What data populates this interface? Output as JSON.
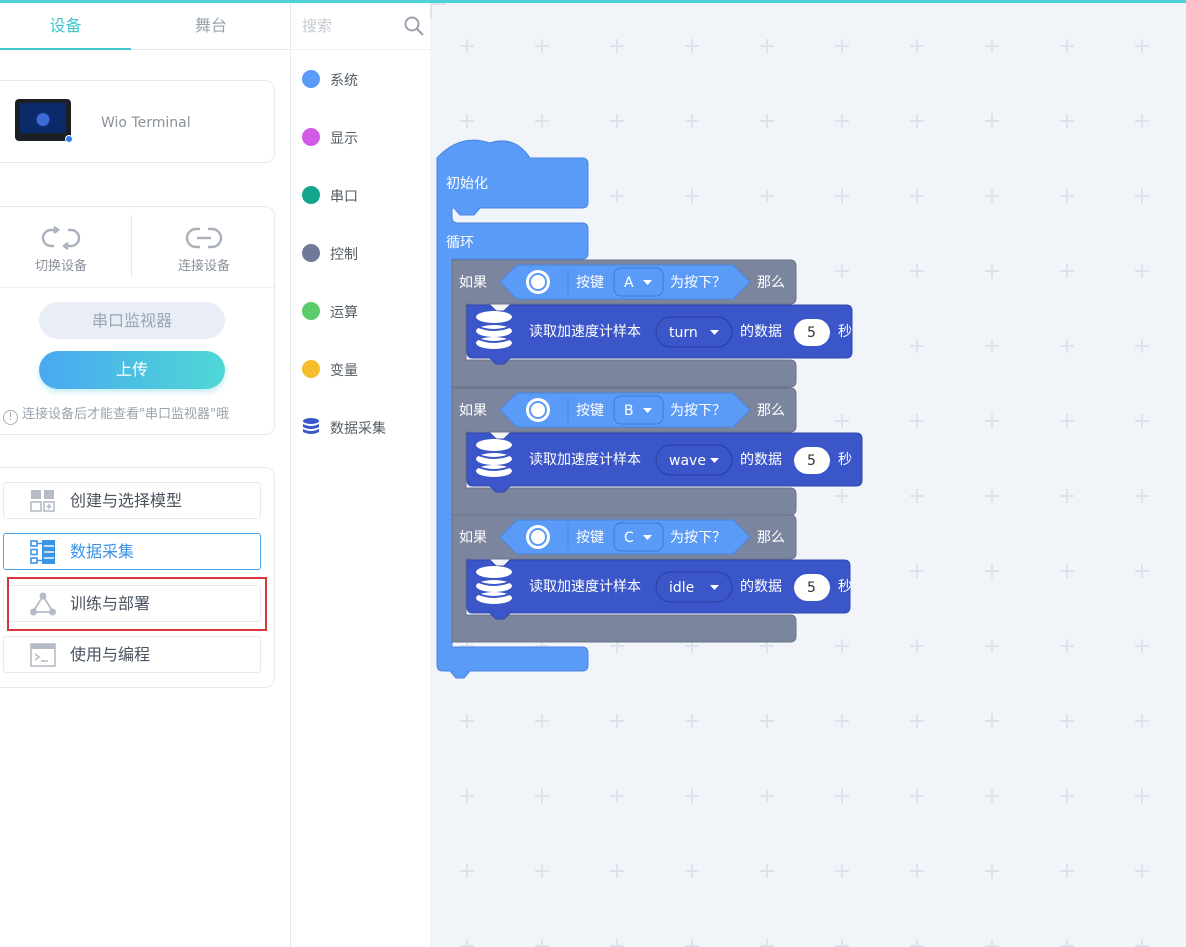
{
  "tabs": [
    {
      "label": "设备"
    },
    {
      "label": "舞台"
    }
  ],
  "device": {
    "name": "Wio Terminal"
  },
  "connection": {
    "switch_label": "切换设备",
    "connect_label": "连接设备",
    "serial_monitor_label": "串口监视器",
    "upload_label": "上传",
    "hint": "连接设备后才能查看\"串口监视器\"哦",
    "hint_icon": "!"
  },
  "menu": [
    {
      "label": "创建与选择模型",
      "icon": "grid-add-icon"
    },
    {
      "label": "数据采集",
      "icon": "data-list-icon",
      "selected": true
    },
    {
      "label": "训练与部署",
      "icon": "network-icon"
    },
    {
      "label": "使用与编程",
      "icon": "terminal-icon"
    }
  ],
  "search": {
    "placeholder": "搜索"
  },
  "categories": [
    {
      "label": "系统",
      "color": "#5b9bf8"
    },
    {
      "label": "显示",
      "color": "#d25be6"
    },
    {
      "label": "串口",
      "color": "#13a58a"
    },
    {
      "label": "控制",
      "color": "#6f7a99"
    },
    {
      "label": "运算",
      "color": "#5ccb69"
    },
    {
      "label": "变量",
      "color": "#f6be2d"
    },
    {
      "label": "数据采集",
      "color": "#3b56c9",
      "icon": "database-icon"
    }
  ],
  "blocks": {
    "init_label": "初始化",
    "loop_label": "循环",
    "if_label": "如果",
    "key_label": "按键",
    "pressed_label": "为按下？",
    "then_label": "那么",
    "read_label": "读取加速度计样本",
    "data_label": "的数据",
    "sec_label": "秒",
    "rows": [
      {
        "key": "A",
        "sample": "turn",
        "seconds": "5"
      },
      {
        "key": "B",
        "sample": "wave",
        "seconds": "5"
      },
      {
        "key": "C",
        "sample": "idle",
        "seconds": "5"
      }
    ]
  },
  "colors": {
    "accent": "#3fc6cf",
    "event_block": "#5b9bf8",
    "control_block": "#7b869e",
    "data_block": "#3b56c9",
    "selected_border": "#49a8f0",
    "highlight": "#d9363e"
  }
}
